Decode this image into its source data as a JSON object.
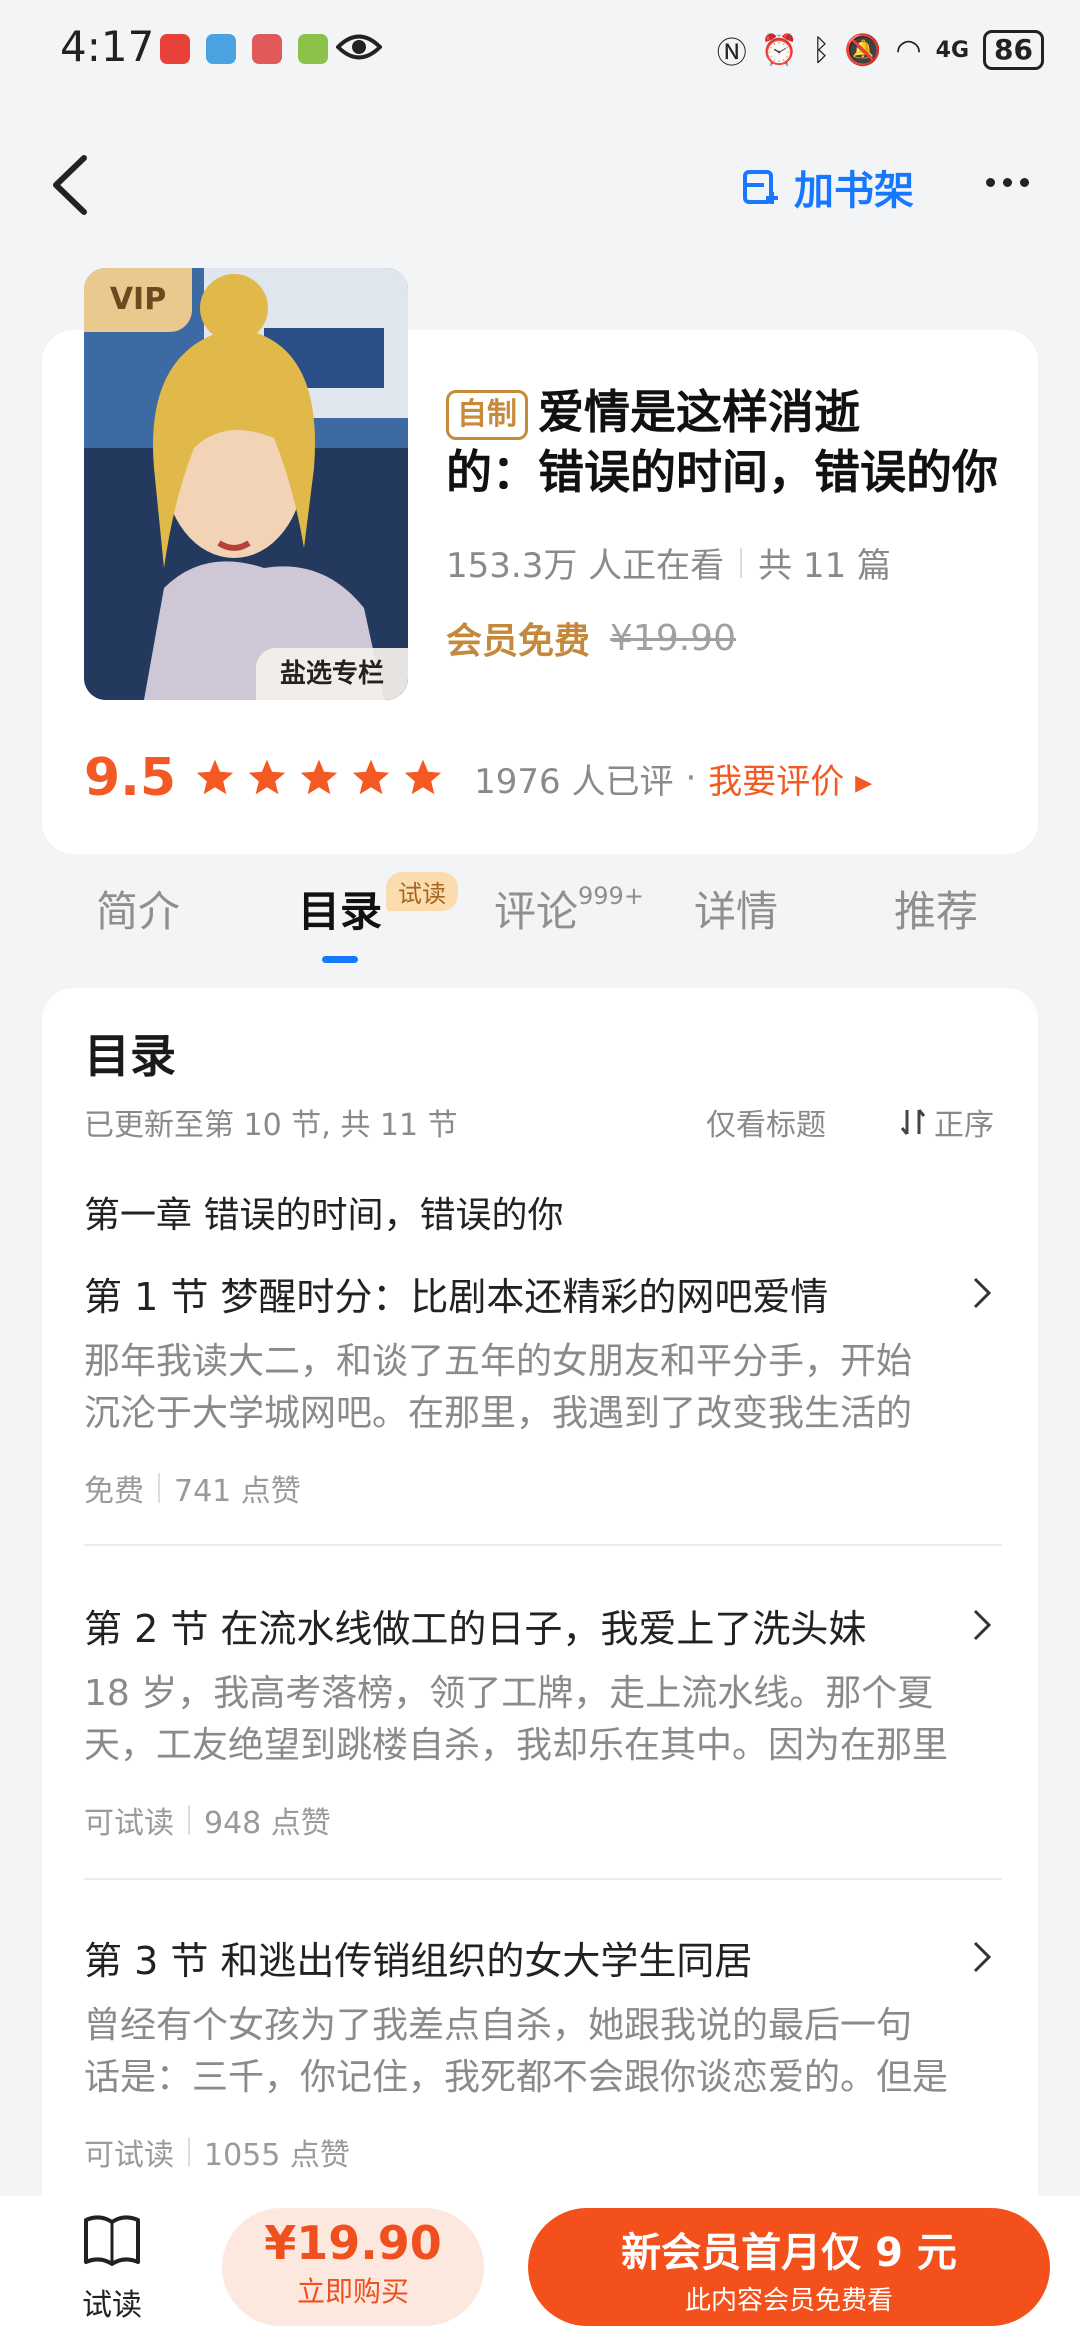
{
  "status_bar": {
    "time": "4:17",
    "battery": "86",
    "network": "4G"
  },
  "nav": {
    "add_shelf_label": "加书架"
  },
  "book": {
    "vip_label": "VIP",
    "column_label": "盐选专栏",
    "tag": "自制",
    "title_line1": "爱情是这样消逝",
    "title_line2": "的：错误的时间，错误的你",
    "readers": "153.3万 人正在看",
    "total": "共 11 篇",
    "member_free": "会员免费",
    "original_price": "¥19.90",
    "score": "9.5",
    "stars": 5,
    "rating_count": "1976 人已评",
    "dot": "·",
    "rate_link": "我要评价 ▸"
  },
  "tabs": [
    {
      "label": "简介"
    },
    {
      "label": "目录",
      "badge": "试读"
    },
    {
      "label": "评论",
      "sup": "999+"
    },
    {
      "label": "详情"
    },
    {
      "label": "推荐"
    }
  ],
  "toc": {
    "heading": "目录",
    "updated": "已更新至第 10 节, 共 11 节",
    "only_titles": "仅看标题",
    "order": "正序",
    "chapter": "第一章 错误的时间，错误的你",
    "sections": [
      {
        "title": "第 1 节 梦醒时分：比剧本还精彩的网吧爱情",
        "desc1": "那年我读大二，和谈了五年的女朋友和平分手，开始",
        "desc2": "沉沦于大学城网吧。在那里，我遇到了改变我生活的",
        "status": "免费",
        "likes": "741 点赞"
      },
      {
        "title": "第 2 节 在流水线做工的日子，我爱上了洗头妹",
        "desc1": "18 岁，我高考落榜，领了工牌，走上流水线。那个夏",
        "desc2": "天，工友绝望到跳楼自杀，我却乐在其中。因为在那里",
        "status": "可试读",
        "likes": "948 点赞"
      },
      {
        "title": "第 3 节 和逃出传销组织的女大学生同居",
        "desc1": "曾经有个女孩为了我差点自杀，她跟我说的最后一句",
        "desc2": "话是：三千，你记住，我死都不会跟你谈恋爱的。但是",
        "status": "可试读",
        "likes": "1055 点赞"
      }
    ]
  },
  "bottom": {
    "try_label": "试读",
    "buy_price": "¥19.90",
    "buy_label": "立即购买",
    "member_title": "新会员首月仅 9 元",
    "member_sub": "此内容会员免费看"
  },
  "colors": {
    "accent_blue": "#1677ff",
    "accent_orange": "#f35a23",
    "gold": "#c4893c"
  }
}
